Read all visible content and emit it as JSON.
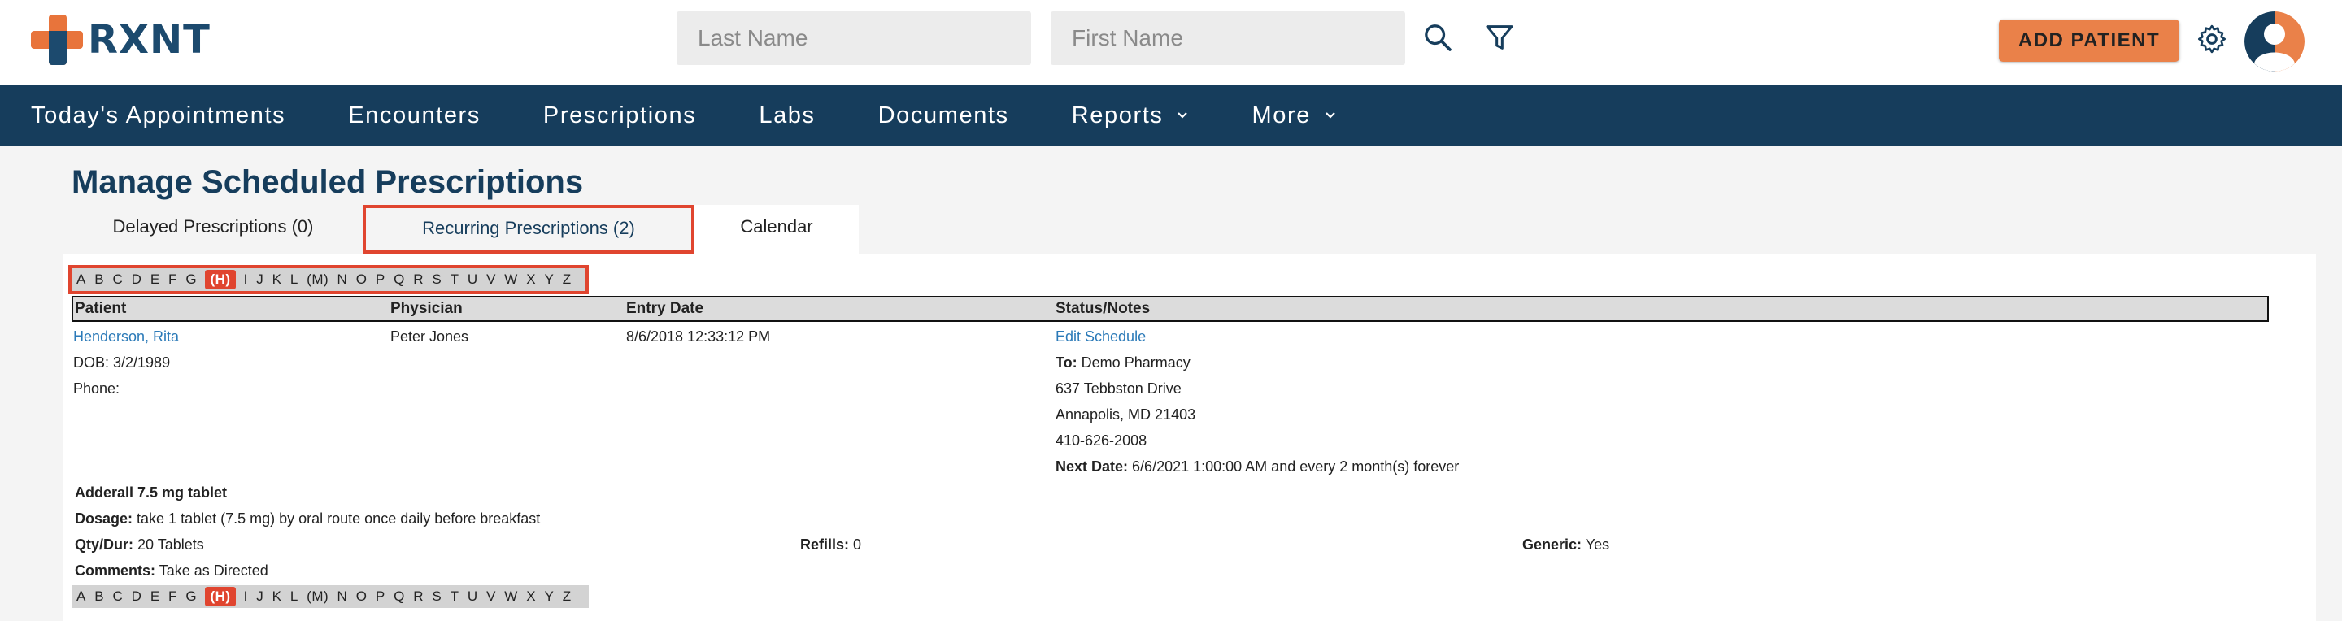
{
  "brand": {
    "name": "RXNT"
  },
  "search": {
    "last_name_placeholder": "Last Name",
    "first_name_placeholder": "First Name"
  },
  "header": {
    "add_patient_label": "ADD PATIENT"
  },
  "nav": {
    "items": [
      {
        "label": "Today's Appointments"
      },
      {
        "label": "Encounters"
      },
      {
        "label": "Prescriptions"
      },
      {
        "label": "Labs"
      },
      {
        "label": "Documents"
      },
      {
        "label": "Reports",
        "has_dropdown": true
      },
      {
        "label": "More",
        "has_dropdown": true
      }
    ]
  },
  "page": {
    "title": "Manage Scheduled Prescriptions"
  },
  "tabs": [
    {
      "label": "Delayed Prescriptions (0)"
    },
    {
      "label": "Recurring Prescriptions (2)"
    },
    {
      "label": "Calendar"
    }
  ],
  "alphabet": [
    "A",
    "B",
    "C",
    "D",
    "E",
    "F",
    "G",
    "(H)",
    "I",
    "J",
    "K",
    "L",
    "(M)",
    "N",
    "O",
    "P",
    "Q",
    "R",
    "S",
    "T",
    "U",
    "V",
    "W",
    "X",
    "Y",
    "Z"
  ],
  "table": {
    "headers": [
      "Patient",
      "Physician",
      "Entry Date",
      "Status/Notes"
    ],
    "row": {
      "patient_name": "Henderson, Rita",
      "dob": "DOB: 3/2/1989",
      "phone": "Phone:",
      "physician": "Peter Jones",
      "entry_date": "8/6/2018 12:33:12 PM",
      "edit_schedule": "Edit Schedule",
      "to_label": "To:",
      "to_value": "Demo Pharmacy",
      "address1": "637 Tebbston Drive",
      "address2": "Annapolis, MD 21403",
      "phone_number": "410-626-2008",
      "next_date_label": "Next Date:",
      "next_date_value": "6/6/2021 1:00:00 AM and every 2 month(s) forever",
      "drug": "Adderall 7.5 mg tablet",
      "dosage_label": "Dosage:",
      "dosage_value": "take 1 tablet (7.5 mg) by oral route once daily before breakfast",
      "qty_label": "Qty/Dur:",
      "qty_value": "20 Tablets",
      "refills_label": "Refills:",
      "refills_value": "0",
      "generic_label": "Generic:",
      "generic_value": "Yes",
      "comments_label": "Comments:",
      "comments_value": "Take as Directed"
    }
  },
  "colors": {
    "brand_blue": "#163d5c",
    "accent_orange": "#ea8149",
    "highlight_red": "#e0452f",
    "link_blue": "#2b7ab8"
  }
}
